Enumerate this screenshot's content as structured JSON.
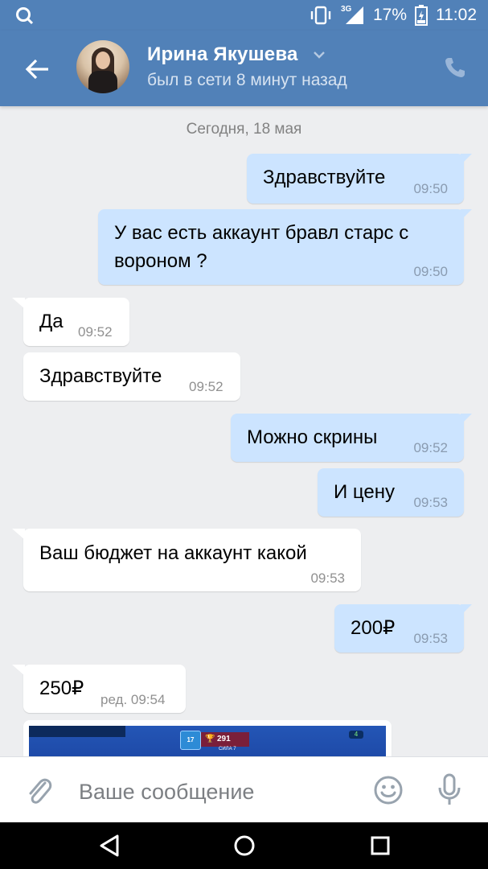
{
  "status_bar": {
    "network": "3G",
    "battery": "17%",
    "time": "11:02"
  },
  "header": {
    "contact_name": "Ирина Якушева",
    "contact_status": "был в сети 8 минут назад"
  },
  "chat": {
    "date_separator": "Сегодня, 18 мая",
    "messages": [
      {
        "direction": "out",
        "text": "Здравствуйте",
        "time": "09:50"
      },
      {
        "direction": "out",
        "text_line1": "У вас есть аккаунт бравл старс с",
        "text_line2": "вороном ?",
        "time": "09:50"
      },
      {
        "direction": "in",
        "text": "Да",
        "time": "09:52"
      },
      {
        "direction": "in",
        "text": "Здравствуйте",
        "time": "09:52"
      },
      {
        "direction": "out",
        "text": "Можно скрины",
        "time": "09:52"
      },
      {
        "direction": "out",
        "text": "И цену",
        "time": "09:53"
      },
      {
        "direction": "in",
        "text": "Ваш бюджет на аккаунт какой",
        "time": "09:53"
      },
      {
        "direction": "out",
        "text": "200₽",
        "time": "09:53"
      },
      {
        "direction": "in",
        "text": "250₽",
        "time": "ред. 09:54"
      }
    ],
    "screenshot_preview": {
      "level": "17",
      "trophies": "291",
      "sub_label": "СИЛА 7",
      "gems": "4"
    }
  },
  "input": {
    "placeholder": "Ваше сообщение"
  },
  "colors": {
    "header_bg": "#5181b8",
    "outgoing_bubble": "#cce4ff",
    "incoming_bubble": "#ffffff",
    "chat_bg": "#edeef0"
  }
}
